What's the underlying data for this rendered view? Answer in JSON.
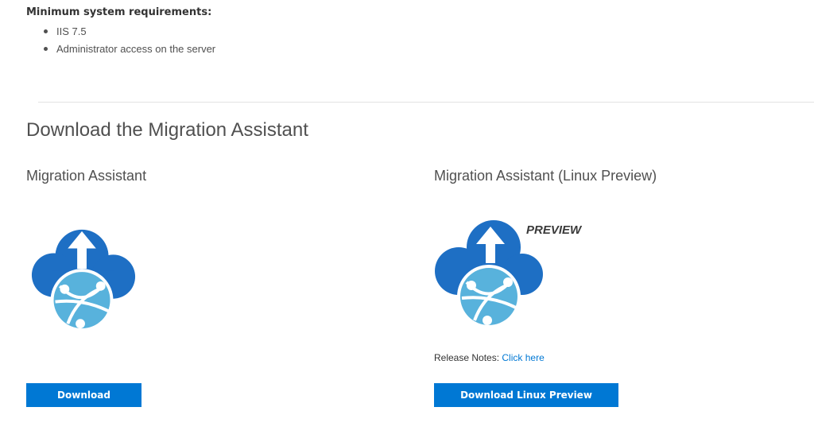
{
  "requirements": {
    "heading": "Minimum system requirements:",
    "items": [
      "IIS 7.5",
      "Administrator access on the server"
    ]
  },
  "download_section": {
    "title": "Download the Migration Assistant",
    "columns": [
      {
        "title": "Migration Assistant",
        "icon": "migration-assistant-icon",
        "button_label": "Download"
      },
      {
        "title": "Migration Assistant (Linux Preview)",
        "icon": "migration-assistant-icon",
        "badge": "PREVIEW",
        "release_notes_label": "Release Notes:",
        "release_notes_link": "Click here",
        "button_label": "Download Linux Preview"
      }
    ]
  },
  "colors": {
    "accent": "#0078d4",
    "cloud_dark": "#1e6fc4",
    "globe": "#58b2dc"
  }
}
